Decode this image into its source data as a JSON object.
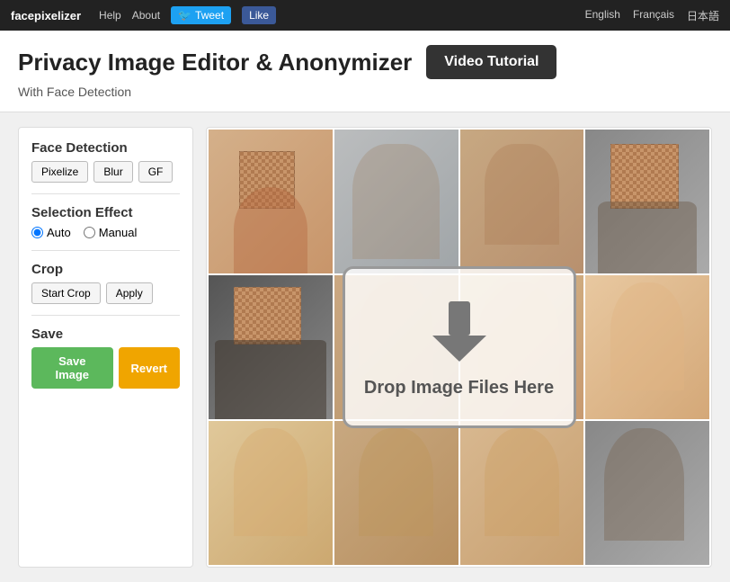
{
  "topnav": {
    "brand": "facepixelizer",
    "help": "Help",
    "about": "About",
    "tweet": "Tweet",
    "like": "Like",
    "languages": [
      "English",
      "Français",
      "日本語"
    ]
  },
  "header": {
    "title": "Privacy Image Editor & Anonymizer",
    "video_tutorial": "Video Tutorial",
    "subtitle": "With Face Detection"
  },
  "sidebar": {
    "face_detection_title": "Face Detection",
    "pixelize": "Pixelize",
    "blur": "Blur",
    "gf": "GF",
    "selection_effect_title": "Selection Effect",
    "auto_label": "Auto",
    "manual_label": "Manual",
    "crop_title": "Crop",
    "start_crop": "Start Crop",
    "apply": "Apply",
    "save_title": "Save",
    "save_image": "Save Image",
    "revert": "Revert"
  },
  "dropzone": {
    "text": "Drop Image Files Here"
  }
}
